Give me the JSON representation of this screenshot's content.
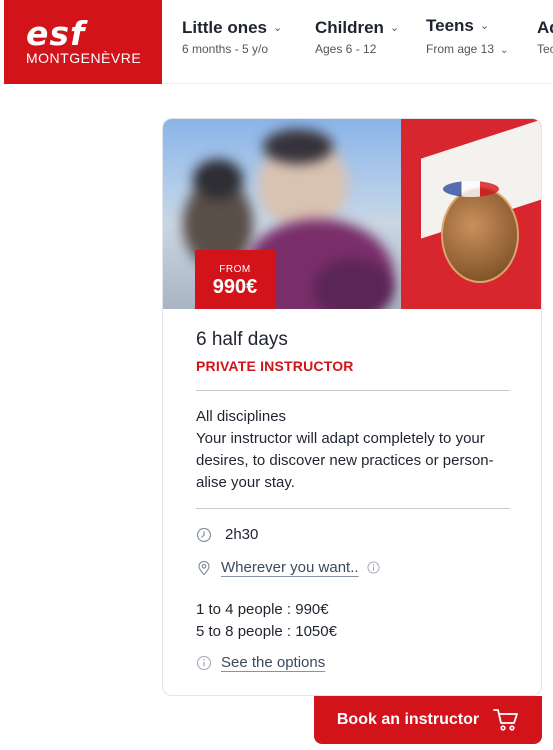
{
  "brand": {
    "logo_text": "esf",
    "location": "MONTGENÈVRE",
    "color": "#d3131a"
  },
  "nav": [
    {
      "title": "Little ones",
      "sub": "6 months - 5 y/o"
    },
    {
      "title": "Children",
      "sub": "Ages 6 - 12"
    },
    {
      "title": "Teens",
      "sub": "From age 13"
    },
    {
      "title": "Ad",
      "sub": "Tec"
    }
  ],
  "card": {
    "badge": {
      "from_label": "FROM",
      "price": "990€"
    },
    "title": "6 half days",
    "subtitle": "PRIVATE INSTRUCTOR",
    "description": [
      "All disciplines",
      "Your instructor will adapt completely to your",
      "desires, to discover new practices or person-",
      "alise your stay."
    ],
    "duration": "2h30",
    "location_link": "Wherever you want..",
    "people": [
      "1 to 4 people : 990€",
      "5 to 8 people : 1050€"
    ],
    "options_link": "See the options"
  },
  "book_button": {
    "label": "Book an instructor",
    "icon": "cart-icon"
  }
}
